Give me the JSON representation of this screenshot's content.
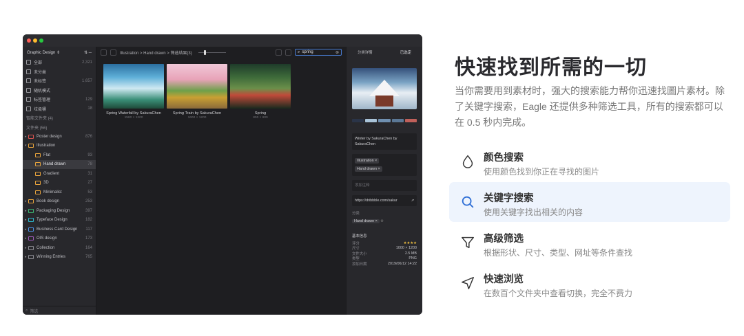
{
  "app": {
    "library_name": "Graphic Design ⇕",
    "sidebar_items": [
      {
        "label": "全部",
        "count": "2,321"
      },
      {
        "label": "未分类",
        "count": ""
      },
      {
        "label": "未标签",
        "count": "1,657"
      },
      {
        "label": "随机模式",
        "count": ""
      },
      {
        "label": "标签管理",
        "count": "129"
      },
      {
        "label": "垃圾桶",
        "count": "18"
      }
    ],
    "smart_folders_label": "智能文件夹 (4)",
    "folders_label": "文件夹 (56)",
    "folders": [
      {
        "label": "Poster design",
        "count": "876",
        "color": "#d9534f",
        "indent": 0,
        "caret": "▸",
        "sel": false
      },
      {
        "label": "Illustration",
        "count": "",
        "color": "#e8a33c",
        "indent": 0,
        "caret": "▾",
        "sel": false
      },
      {
        "label": "Flat",
        "count": "93",
        "color": "#e8a33c",
        "indent": 1,
        "caret": "",
        "sel": false
      },
      {
        "label": "Hand drawn",
        "count": "78",
        "color": "#e8a33c",
        "indent": 1,
        "caret": "",
        "sel": true
      },
      {
        "label": "Gradient",
        "count": "31",
        "color": "#e8a33c",
        "indent": 1,
        "caret": "",
        "sel": false
      },
      {
        "label": "3D",
        "count": "27",
        "color": "#e8a33c",
        "indent": 1,
        "caret": "",
        "sel": false
      },
      {
        "label": "Minimalist",
        "count": "53",
        "color": "#e8a33c",
        "indent": 1,
        "caret": "",
        "sel": false
      },
      {
        "label": "Book design",
        "count": "253",
        "color": "#e8a33c",
        "indent": 0,
        "caret": "▸",
        "sel": false
      },
      {
        "label": "Packaging Design",
        "count": "397",
        "color": "#3cb371",
        "indent": 0,
        "caret": "▸",
        "sel": false
      },
      {
        "label": "Typeface Design",
        "count": "182",
        "color": "#2bb5c9",
        "indent": 0,
        "caret": "▸",
        "sel": false
      },
      {
        "label": "Business Card Design",
        "count": "117",
        "color": "#4a90e2",
        "indent": 0,
        "caret": "▸",
        "sel": false
      },
      {
        "label": "OIS design",
        "count": "173",
        "color": "#9b59b6",
        "indent": 0,
        "caret": "▸",
        "sel": false
      },
      {
        "label": "Collection",
        "count": "164",
        "color": "#8a8a90",
        "indent": 0,
        "caret": "▸",
        "sel": false
      },
      {
        "label": "Winning Entries",
        "count": "765",
        "color": "#8a8a90",
        "indent": 0,
        "caret": "▸",
        "sel": false
      }
    ],
    "filter_placeholder": "筛选",
    "breadcrumb": "Illustration  >  Hand drawn  >  筛选结果(3)",
    "search_value": "spring",
    "items": [
      {
        "title": "Spring Waterfall by SakuraChen",
        "size": "1580 × 1200"
      },
      {
        "title": "Spring Train by SakuraChen",
        "size": "1600 × 1200"
      },
      {
        "title": "Spring",
        "size": "800 × 600"
      }
    ],
    "inspector": {
      "tab_left": "分类详情",
      "tab_right": "已选定",
      "palette": [
        "#2a3448",
        "#a9c3d8",
        "#6f8fb0",
        "#5b7896",
        "#c0605a"
      ],
      "name": "Winter by SakuraChen by SakuraChen",
      "tags": [
        "Illustration ×",
        "Hand drawn ×"
      ],
      "annotation_placeholder": "添加注释",
      "url": "https://dribbble.com/sakur",
      "folder_label": "分类",
      "folder_value": "Hand drawn  ×",
      "basic_info_label": "基本信息",
      "info": [
        {
          "k": "评分",
          "v": "★★★★"
        },
        {
          "k": "尺寸",
          "v": "1000 × 1200"
        },
        {
          "k": "文件大小",
          "v": "2.5 MB"
        },
        {
          "k": "类型",
          "v": "PNG"
        },
        {
          "k": "添加日期",
          "v": "2019/06/12 14:22"
        }
      ]
    }
  },
  "promo": {
    "heading": "快速找到所需的一切",
    "description": "当你需要用到素材时，强大的搜索能力帮你迅速找圖片素材。除了关键字搜索，Eagle 还提供多种筛选工具，所有的搜索都可以在 0.5 秒内完成。",
    "features": [
      {
        "title": "颜色搜索",
        "desc": "使用颜色找到你正在寻找的图片",
        "icon": "drop-icon",
        "highlight": false
      },
      {
        "title": "关键字搜索",
        "desc": "使用关键字找出相关的内容",
        "icon": "search-icon",
        "highlight": true
      },
      {
        "title": "高级筛选",
        "desc": "根据形状、尺寸、类型、网址等条件查找",
        "icon": "filter-icon",
        "highlight": false
      },
      {
        "title": "快速浏览",
        "desc": "在数百个文件夹中查看切换，完全不费力",
        "icon": "navigate-icon",
        "highlight": false
      }
    ]
  }
}
